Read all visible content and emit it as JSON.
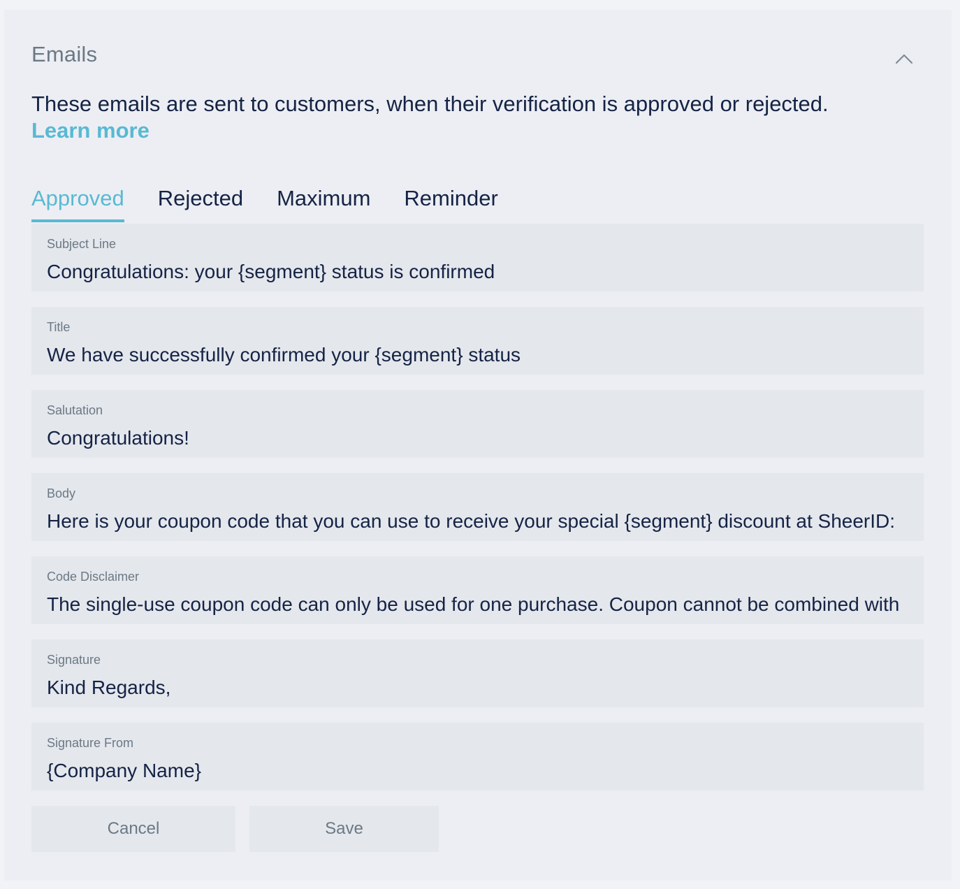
{
  "section": {
    "title": "Emails",
    "intro": "These emails are sent to customers, when their verification is approved or rejected.",
    "learn_more": "Learn more"
  },
  "tabs": [
    {
      "label": "Approved",
      "active": true
    },
    {
      "label": "Rejected",
      "active": false
    },
    {
      "label": "Maximum",
      "active": false
    },
    {
      "label": "Reminder",
      "active": false
    }
  ],
  "fields": [
    {
      "label": "Subject Line",
      "value": "Congratulations: your {segment} status is confirmed"
    },
    {
      "label": "Title",
      "value": "We have successfully confirmed your {segment} status"
    },
    {
      "label": "Salutation",
      "value": "Congratulations!"
    },
    {
      "label": "Body",
      "value": "Here is your coupon code that you can use to receive your special {segment} discount at SheerID:"
    },
    {
      "label": "Code Disclaimer",
      "value": "The single-use coupon code can only be used for one purchase. Coupon cannot be combined with"
    },
    {
      "label": "Signature",
      "value": "Kind Regards,"
    },
    {
      "label": "Signature From",
      "value": "{Company Name}"
    }
  ],
  "actions": {
    "cancel_label": "Cancel",
    "save_label": "Save"
  },
  "colors": {
    "accent": "#59b9d3",
    "text": "#152345",
    "muted": "#6b7985",
    "panel": "#eceef3",
    "field_bg": "#e4e7ec"
  },
  "icons": {
    "collapse": "chevron-up-icon"
  }
}
